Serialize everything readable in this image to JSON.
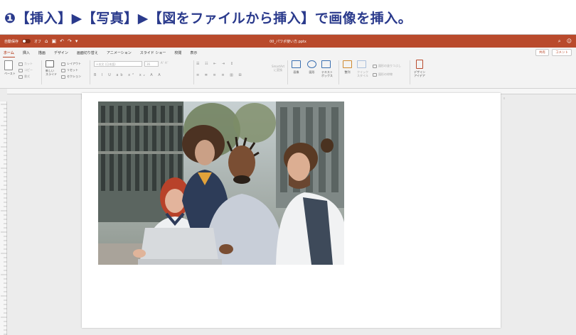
{
  "caption": {
    "text": "❶【挿入】▶【写真】▶【図をファイルから挿入】で画像を挿入。"
  },
  "titlebar": {
    "autosave_label": "自動保存",
    "autosave_state": "オフ",
    "filename": "00_パワポ使い方.pptx"
  },
  "tabs": [
    "ホーム",
    "挿入",
    "描画",
    "デザイン",
    "画面切り替え",
    "アニメーション",
    "スライド ショー",
    "校閲",
    "表示"
  ],
  "active_tab": "ホーム",
  "tabs_right": {
    "share": "共有",
    "comment": "コメント"
  },
  "ribbon": {
    "paste": "ペースト",
    "cut": "カット",
    "copy": "コピー",
    "format": "書式",
    "new_slide": "新しい\nスライド",
    "layout": "レイアウト",
    "reset": "リセット",
    "section": "セクション",
    "font_name": "+本文 (日本語)",
    "font_size": "36",
    "smartart": "SmartArt\nに変換",
    "picture": "画像",
    "shapes": "図形",
    "textbox": "テキスト\nボックス",
    "arrange": "整列",
    "quick_styles": "クイック\nスタイル",
    "shape_fill": "図形の塗りつぶし",
    "shape_outline": "図形の枠線",
    "design_ideas": "デザイン\nアイデア"
  },
  "colors": {
    "accent": "#b94a2c",
    "caption": "#2a3a8c"
  }
}
